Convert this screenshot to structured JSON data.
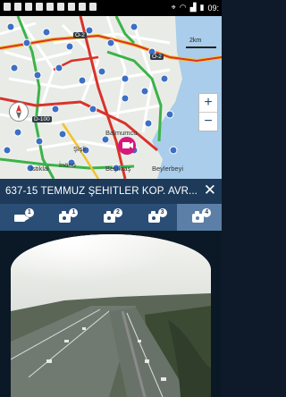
{
  "status_bar": {
    "time": "09:"
  },
  "map": {
    "scale_label": "2km",
    "zoom_in_label": "+",
    "zoom_out_label": "−",
    "road_labels": [
      "O-2",
      "O-2",
      "D-100"
    ],
    "place_labels": [
      "Balmumcu",
      "Şişli",
      "İstiklal",
      "İnönü",
      "Beşiktaş",
      "Beylerbeyi"
    ]
  },
  "camera_panel": {
    "title": "637-15 TEMMUZ ŞEHİTLER KÖP. AVR...",
    "close_label": "✕",
    "tabs": [
      {
        "icon": "video-camera-icon",
        "badge": "1",
        "active": false
      },
      {
        "icon": "camera-icon",
        "badge": "1",
        "active": false
      },
      {
        "icon": "camera-icon",
        "badge": "2",
        "active": false
      },
      {
        "icon": "camera-icon",
        "badge": "3",
        "active": false
      },
      {
        "icon": "camera-icon",
        "badge": "4",
        "active": true
      }
    ]
  },
  "colors": {
    "header": "#1d3a5a",
    "tabs": "#2a4e75",
    "active_tab": "#5b7fa7",
    "traffic_red": "#d9322b",
    "traffic_green": "#3bb34a",
    "traffic_yellow": "#f2c230",
    "marker": "#d6187a"
  }
}
